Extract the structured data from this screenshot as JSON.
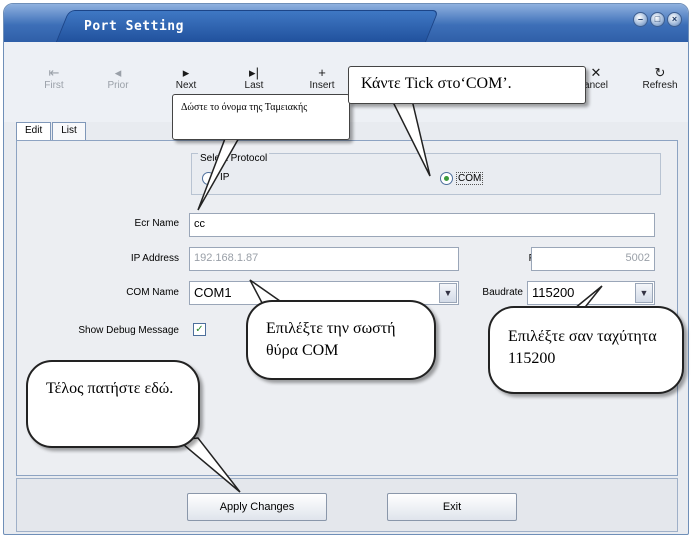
{
  "window": {
    "title": "Port Setting",
    "title_buttons": [
      "minimize-icon",
      "maximize-icon",
      "close-icon"
    ]
  },
  "toolbar": {
    "items": [
      {
        "label": "First",
        "icon": "first-icon",
        "glyph": "⇤",
        "enabled": false
      },
      {
        "label": "Prior",
        "icon": "prior-icon",
        "glyph": "◂",
        "enabled": false
      },
      {
        "label": "Next",
        "icon": "next-icon",
        "glyph": "▸",
        "enabled": true
      },
      {
        "label": "Last",
        "icon": "last-icon",
        "glyph": "▸|",
        "enabled": true
      },
      {
        "label": "Insert",
        "icon": "plus-icon",
        "glyph": "+",
        "enabled": true
      },
      {
        "label": "ancel",
        "icon": "cancel-icon",
        "glyph": "✕",
        "enabled": true
      },
      {
        "label": "Refresh",
        "icon": "refresh-icon",
        "glyph": "↻",
        "enabled": true
      }
    ]
  },
  "tabs": [
    {
      "label": "Edit",
      "active": true
    },
    {
      "label": "List",
      "active": false
    }
  ],
  "form": {
    "protocol_legend": "Select Protocol",
    "protocol_options": [
      {
        "label": "IP",
        "selected": false
      },
      {
        "label": "COM",
        "selected": true
      }
    ],
    "ecr_name_label": "Ecr Name",
    "ecr_name_value": "cc",
    "ip_address_label": "IP Address",
    "ip_address_value": "192.168.1.87",
    "port_label": "Port",
    "port_value": "5002",
    "com_name_label": "COM Name",
    "com_name_value": "COM1",
    "baudrate_label": "Baudrate",
    "baudrate_value": "115200",
    "debug_label": "Show Debug Message",
    "debug_checked": true
  },
  "buttons": {
    "apply": "Apply Changes",
    "exit": "Exit"
  },
  "callouts": {
    "name_hint": "Δώστε το όνομα της Ταμειακής",
    "com_tick": "Κάντε Tick στο‘COM’.",
    "com_port": "Επιλέξτε την σωστή θύρα COM",
    "baudrate": "Επιλέξτε σαν ταχύτητα 115200",
    "apply": "Τέλος πατήστε εδώ."
  },
  "colors": {
    "title_bar": "#3d6fb8",
    "panel": "#eceef2",
    "radio_dot": "#3c9a3c"
  }
}
